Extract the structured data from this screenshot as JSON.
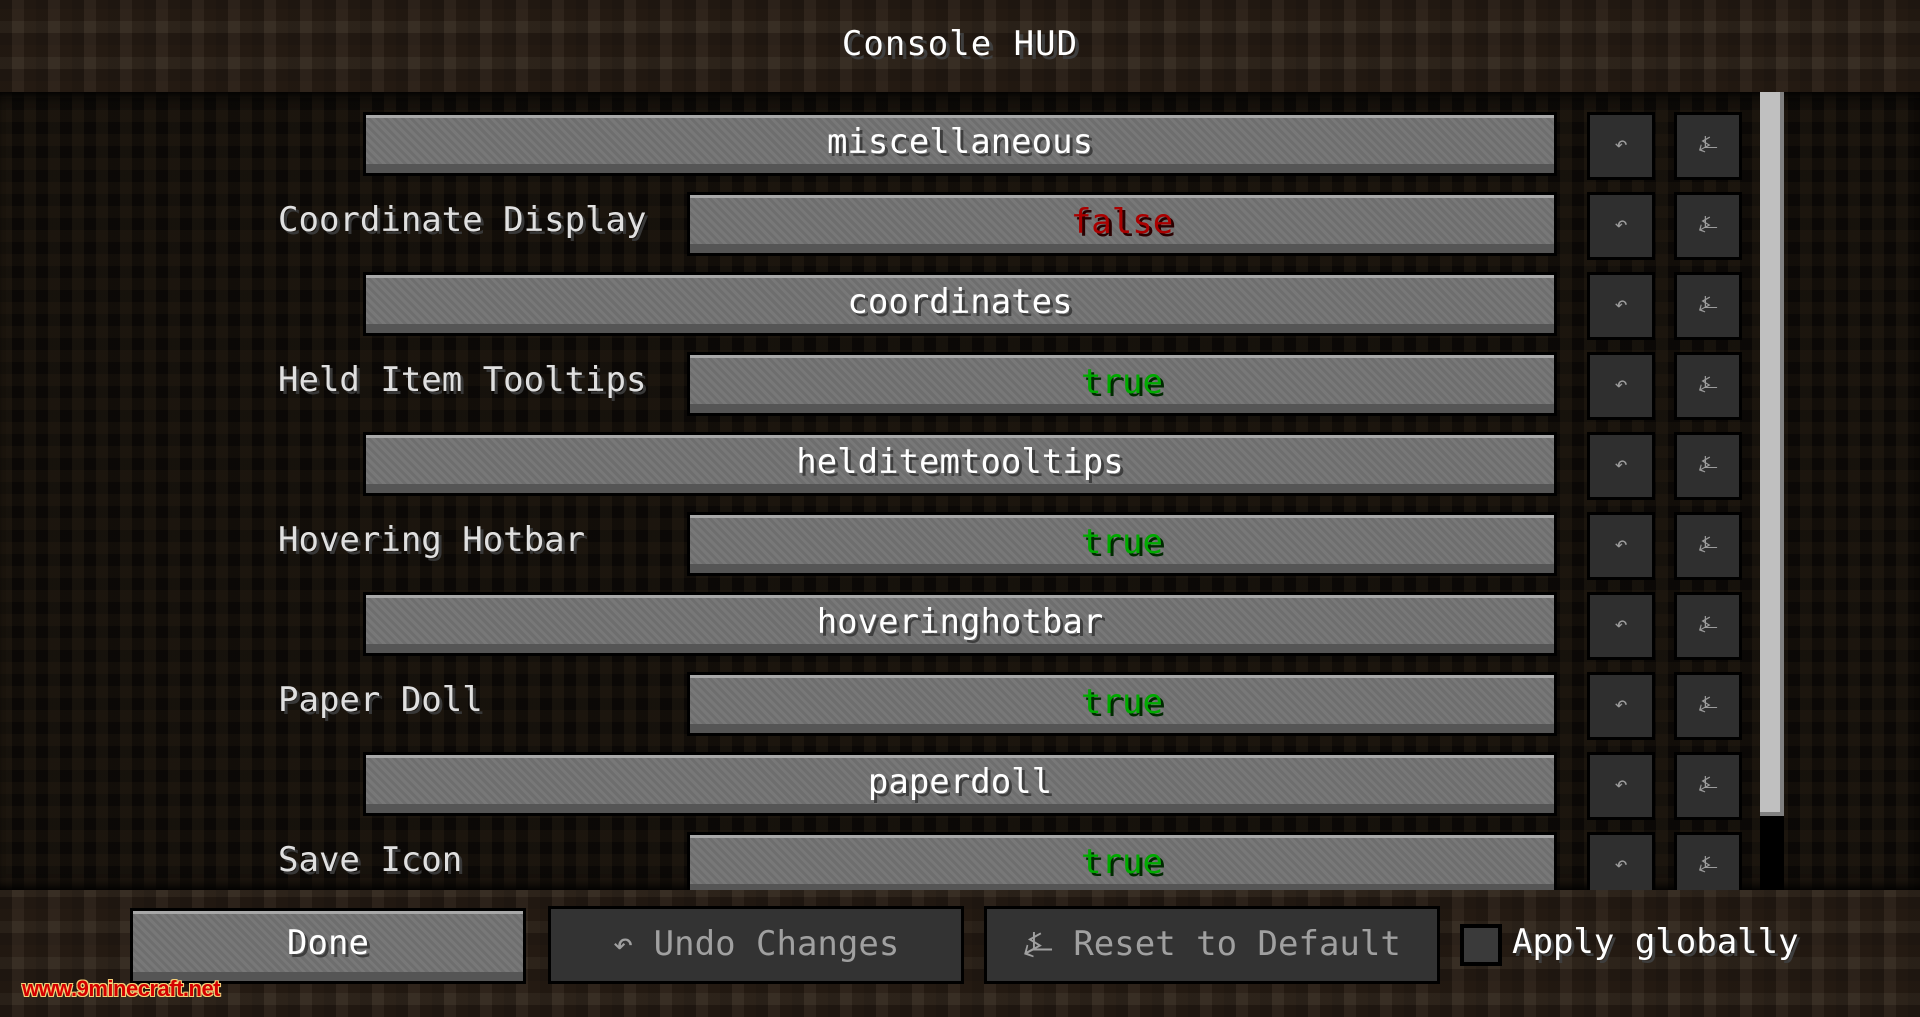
{
  "screen": {
    "title": "Console HUD"
  },
  "rows": [
    {
      "type": "category",
      "text": "miscellaneous"
    },
    {
      "type": "value",
      "label": "Coordinate Display",
      "value": "false"
    },
    {
      "type": "category",
      "text": "coordinates"
    },
    {
      "type": "value",
      "label": "Held Item Tooltips",
      "value": "true"
    },
    {
      "type": "category",
      "text": "helditemtooltips"
    },
    {
      "type": "value",
      "label": "Hovering Hotbar",
      "value": "true"
    },
    {
      "type": "category",
      "text": "hoveringhotbar"
    },
    {
      "type": "value",
      "label": "Paper Doll",
      "value": "true"
    },
    {
      "type": "category",
      "text": "paperdoll"
    },
    {
      "type": "value",
      "label": "Save Icon",
      "value": "true"
    }
  ],
  "icons": {
    "undo": "undo-arrow-icon",
    "reset": "reset-default-icon",
    "undo_glyph": "↶",
    "reset_glyph": "⍼"
  },
  "colors": {
    "false": "#aa0000",
    "true": "#00aa00"
  },
  "footer": {
    "done_label": "Done",
    "undo_label": "Undo Changes",
    "reset_label": "Reset to Default",
    "apply_globally_label": "Apply globally",
    "apply_globally_checked": false
  },
  "watermark": "www.9minecraft.net"
}
